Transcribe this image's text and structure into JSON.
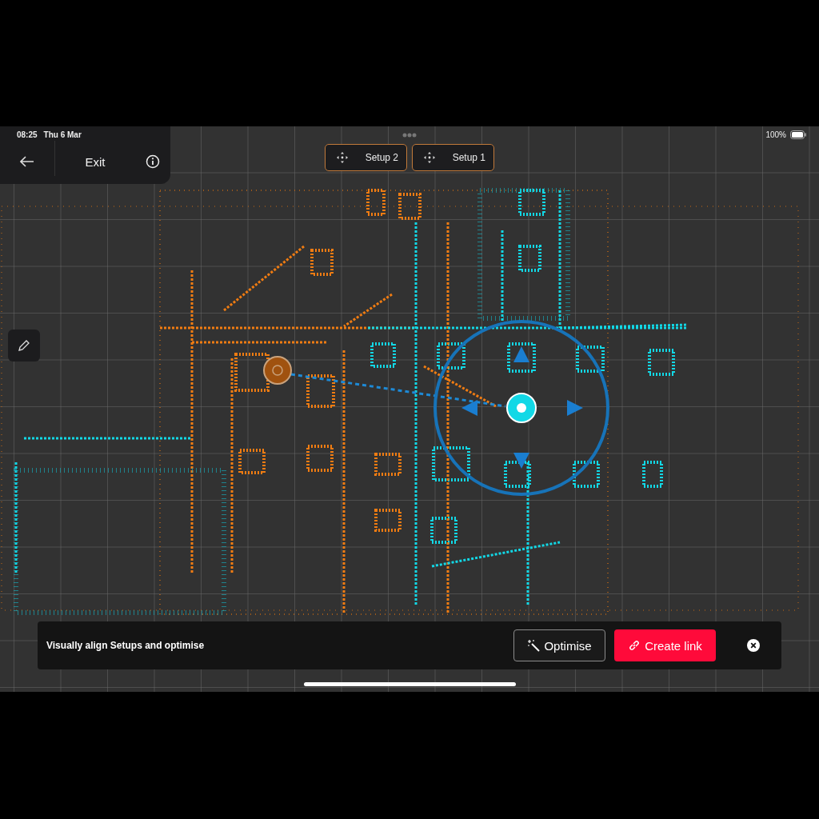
{
  "status_bar": {
    "time": "08:25",
    "date": "Thu 6 Mar",
    "battery": "100%"
  },
  "nav_panel": {
    "title": "Exit"
  },
  "setups": [
    {
      "label": "Setup 2",
      "selected": false
    },
    {
      "label": "Setup 1",
      "selected": false
    }
  ],
  "bottom_bar": {
    "message": "Visually align Setups and optimise",
    "buttons": [
      {
        "label": "Optimise",
        "kind": "outline"
      },
      {
        "label": "Create link",
        "kind": "primary"
      }
    ]
  }
}
